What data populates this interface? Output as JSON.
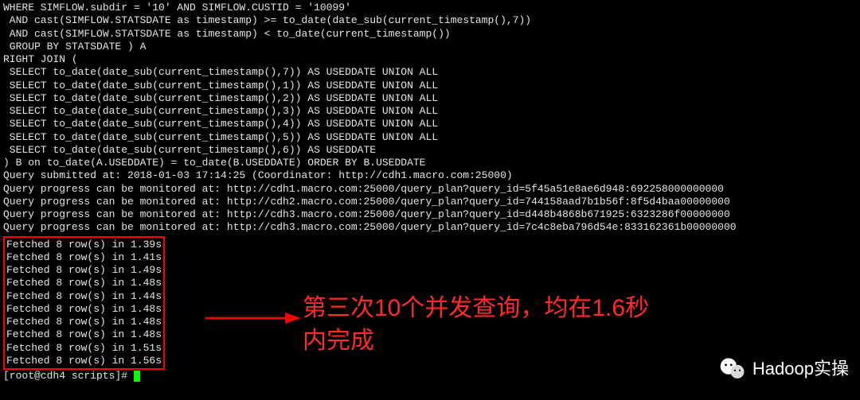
{
  "sql_lines": [
    "WHERE SIMFLOW.subdir = '10' AND SIMFLOW.CUSTID = '10099'",
    " AND cast(SIMFLOW.STATSDATE as timestamp) >= to_date(date_sub(current_timestamp(),7))",
    " AND cast(SIMFLOW.STATSDATE as timestamp) < to_date(current_timestamp())",
    " GROUP BY STATSDATE ) A",
    "RIGHT JOIN (",
    " SELECT to_date(date_sub(current_timestamp(),7)) AS USEDDATE UNION ALL",
    " SELECT to_date(date_sub(current_timestamp(),1)) AS USEDDATE UNION ALL",
    " SELECT to_date(date_sub(current_timestamp(),2)) AS USEDDATE UNION ALL",
    " SELECT to_date(date_sub(current_timestamp(),3)) AS USEDDATE UNION ALL",
    " SELECT to_date(date_sub(current_timestamp(),4)) AS USEDDATE UNION ALL",
    " SELECT to_date(date_sub(current_timestamp(),5)) AS USEDDATE UNION ALL",
    " SELECT to_date(date_sub(current_timestamp(),6)) AS USEDDATE",
    ") B on to_date(A.USEDDATE) = to_date(B.USEDDATE) ORDER BY B.USEDDATE",
    "Query submitted at: 2018-01-03 17:14:25 (Coordinator: http://cdh1.macro.com:25000)",
    "Query progress can be monitored at: http://cdh1.macro.com:25000/query_plan?query_id=5f45a51e8ae6d948:692258000000000",
    "Query progress can be monitored at: http://cdh2.macro.com:25000/query_plan?query_id=744158aad7b1b56f:8f5d4baa00000000",
    "Query progress can be monitored at: http://cdh3.macro.com:25000/query_plan?query_id=d448b4868b671925:6323286f00000000",
    "Query progress can be monitored at: http://cdh3.macro.com:25000/query_plan?query_id=7c4c8eba796d54e:833162361b00000000"
  ],
  "fetched_lines": [
    "Fetched 8 row(s) in 1.39s",
    "Fetched 8 row(s) in 1.41s",
    "Fetched 8 row(s) in 1.49s",
    "Fetched 8 row(s) in 1.48s",
    "Fetched 8 row(s) in 1.44s",
    "Fetched 8 row(s) in 1.48s",
    "Fetched 8 row(s) in 1.48s",
    "Fetched 8 row(s) in 1.48s",
    "Fetched 8 row(s) in 1.51s",
    "Fetched 8 row(s) in 1.56s"
  ],
  "prompt": "[root@cdh4 scripts]# ",
  "annotation": {
    "line1": "第三次10个并发查询，均在1.6秒",
    "line2": "内完成"
  },
  "watermark_text": "Hadoop实操"
}
